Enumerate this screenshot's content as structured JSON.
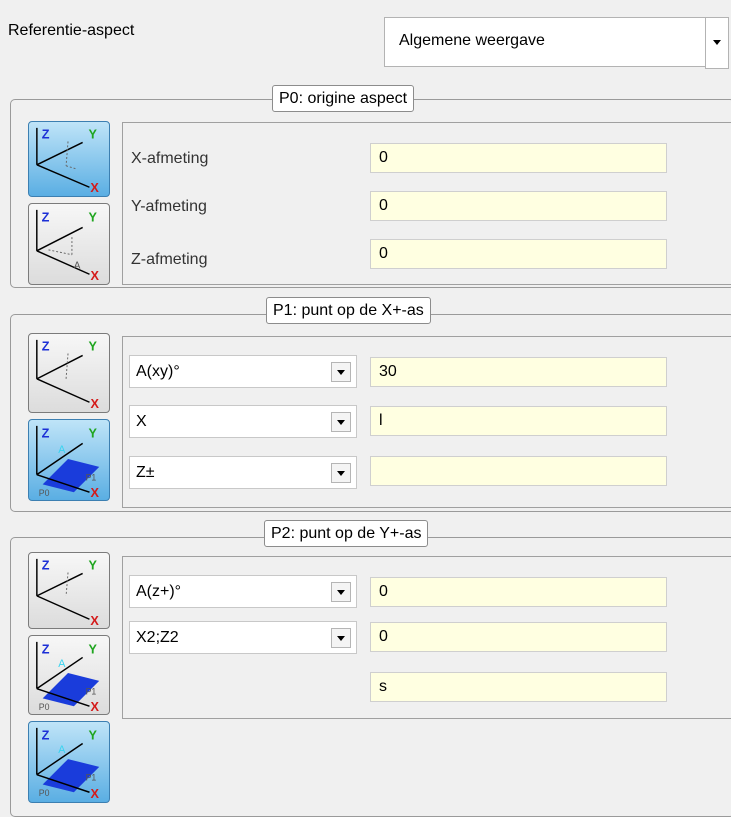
{
  "reference": {
    "label": "Referentie-aspect",
    "selected": "Algemene weergave"
  },
  "p0": {
    "legend": "P0: origine aspect",
    "labels": [
      "X-afmeting",
      "Y-afmeting",
      "Z-afmeting"
    ],
    "values": [
      "0",
      "0",
      "0"
    ]
  },
  "p1": {
    "legend": "P1: punt op de X+-as",
    "dropdowns": [
      "A(xy)°",
      "X",
      "Z±"
    ],
    "values": [
      "30",
      "l",
      ""
    ]
  },
  "p2": {
    "legend": "P2: punt op de Y+-as",
    "dropdowns": [
      "A(z+)°",
      "X2;Z2"
    ],
    "values": [
      "0",
      "0",
      "s"
    ]
  },
  "icon_text": {
    "z": "Z",
    "y": "Y",
    "x": "X",
    "a": "A",
    "p0": "P0",
    "p1": "P1"
  },
  "colors": {
    "field_bg": "#ffffe1",
    "active_button": "#5aaee3",
    "axis_z": "#1c2fd6",
    "axis_y": "#1fa51f",
    "axis_x": "#d41a1a"
  }
}
